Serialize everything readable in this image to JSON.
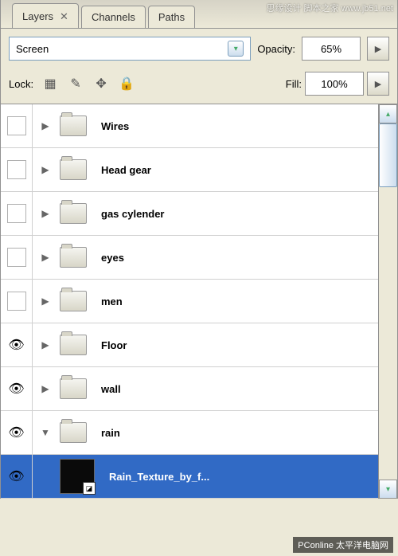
{
  "tabs": {
    "layers": "Layers",
    "channels": "Channels",
    "paths": "Paths"
  },
  "blend_mode": "Screen",
  "opacity_label": "Opacity:",
  "opacity_value": "65%",
  "lock_label": "Lock:",
  "fill_label": "Fill:",
  "fill_value": "100%",
  "layers": [
    {
      "name": "Wires",
      "visible": false,
      "expanded": false,
      "type": "folder"
    },
    {
      "name": "Head gear",
      "visible": false,
      "expanded": false,
      "type": "folder"
    },
    {
      "name": "gas cylender",
      "visible": false,
      "expanded": false,
      "type": "folder"
    },
    {
      "name": "eyes",
      "visible": false,
      "expanded": false,
      "type": "folder"
    },
    {
      "name": "men",
      "visible": false,
      "expanded": false,
      "type": "folder"
    },
    {
      "name": "Floor",
      "visible": true,
      "expanded": false,
      "type": "folder"
    },
    {
      "name": "wall",
      "visible": true,
      "expanded": false,
      "type": "folder"
    },
    {
      "name": "rain",
      "visible": true,
      "expanded": true,
      "type": "folder"
    },
    {
      "name": "Rain_Texture_by_f...",
      "visible": true,
      "type": "layer",
      "selected": true,
      "nested": true
    }
  ],
  "watermarks": {
    "top": "思缘设计 脚本之家 www.jb51.net",
    "bottom": "PConline 太平洋电脑网"
  }
}
